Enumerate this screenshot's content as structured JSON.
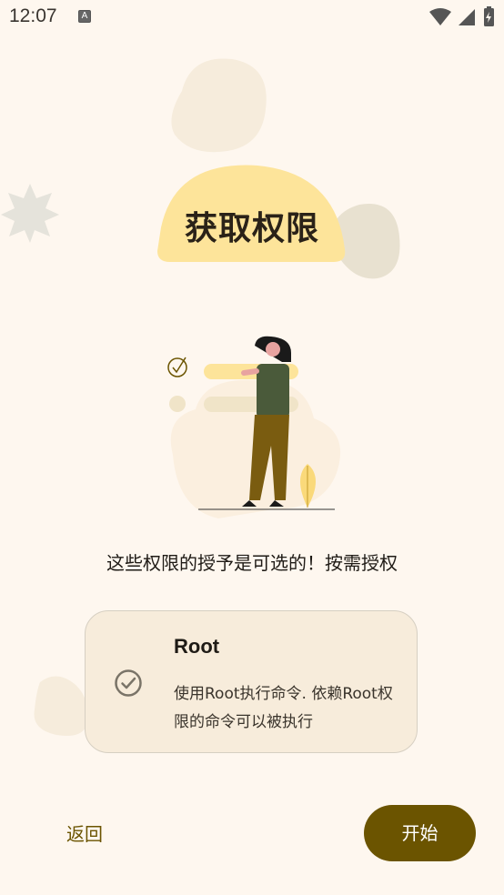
{
  "status_bar": {
    "time": "12:07",
    "notification_icon": "A",
    "icons": [
      "wifi-icon",
      "signal-icon",
      "battery-icon"
    ]
  },
  "page": {
    "title": "获取权限",
    "subtitle": "这些权限的授予是可选的！按需授权"
  },
  "permission_card": {
    "title": "Root",
    "description": "使用Root执行命令. 依赖Root权限的命令可以被执行",
    "checked": true,
    "icon": "check-circle-icon"
  },
  "footer": {
    "back_label": "返回",
    "start_label": "开始"
  },
  "colors": {
    "background": "#fef7ef",
    "accent": "#6b5400",
    "title_blob": "#fde49a",
    "card": "#f7ecdb"
  }
}
